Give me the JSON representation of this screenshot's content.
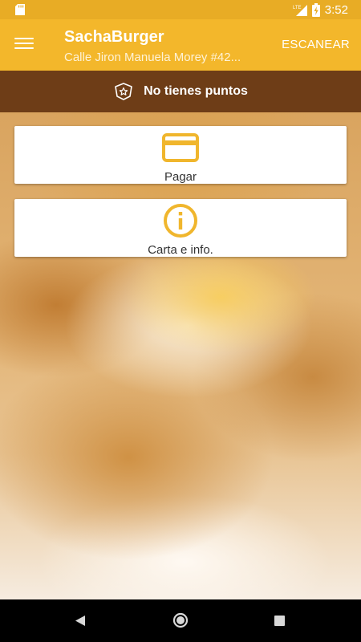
{
  "status_bar": {
    "network": "LTE",
    "time": "3:52",
    "icons": [
      "sd-card-icon",
      "lte-signal-icon",
      "battery-charging-icon"
    ]
  },
  "app_bar": {
    "title": "SachaBurger",
    "subtitle": "Calle Jiron Manuela Morey #42...",
    "action_label": "ESCANEAR",
    "colors": {
      "background": "#f3b72b",
      "status_bar": "#e8ac25"
    }
  },
  "points_bar": {
    "text": "No tienes puntos",
    "icon": "star-badge-icon",
    "background": "#6e3d17"
  },
  "cards": [
    {
      "label": "Pagar",
      "icon": "credit-card-icon",
      "icon_color": "#f0b62d"
    },
    {
      "label": "Carta e info.",
      "icon": "info-icon",
      "icon_color": "#f0b62d"
    }
  ],
  "nav_bar": {
    "icons": [
      "back-icon",
      "home-icon",
      "recent-apps-icon"
    ]
  }
}
